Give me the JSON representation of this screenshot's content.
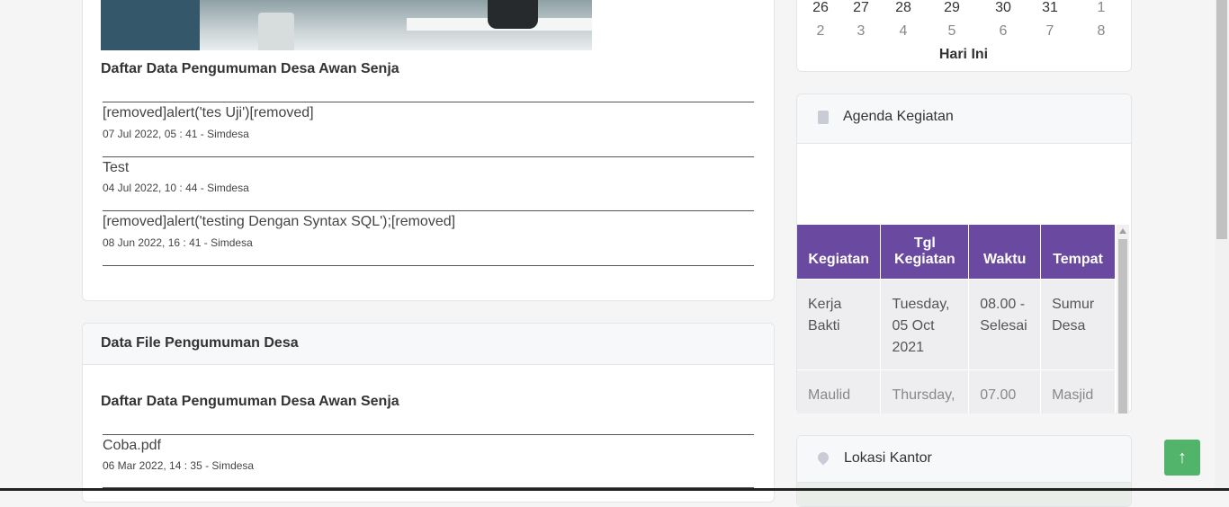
{
  "left": {
    "announcements_card": {
      "title": "Daftar Data Pengumuman Desa Awan Senja",
      "items": [
        {
          "title": "[removed]alert('tes Uji')[removed]",
          "meta": "07 Jul 2022, 05 : 41 - Simdesa"
        },
        {
          "title": "Test",
          "meta": "04 Jul 2022, 10 : 44 - Simdesa"
        },
        {
          "title": "[removed]alert('testing Dengan Syntax SQL');[removed]",
          "meta": "08 Jun 2022, 16 : 41 - Simdesa"
        }
      ]
    },
    "files_card": {
      "header": "Data File Pengumuman Desa",
      "title": "Daftar Data Pengumuman Desa Awan Senja",
      "items": [
        {
          "title": "Coba.pdf",
          "meta": "06 Mar 2022, 14 : 35 - Simdesa"
        }
      ]
    }
  },
  "right": {
    "calendar": {
      "row1": [
        "26",
        "27",
        "28",
        "29",
        "30",
        "31",
        "1"
      ],
      "row2": [
        "2",
        "3",
        "4",
        "5",
        "6",
        "7",
        "8"
      ],
      "today_label": "Hari Ini"
    },
    "agenda": {
      "header": "Agenda Kegiatan",
      "icon": "clipboard-icon",
      "columns": [
        "Kegiatan",
        "Tgl Kegiatan",
        "Waktu",
        "Tempat"
      ],
      "rows": [
        [
          "Kerja Bakti",
          "Tuesday, 05 Oct 2021",
          "08.00 - Selesai",
          "Sumur Desa"
        ],
        [
          "Maulid",
          "Thursday,",
          "07.00",
          "Masjid"
        ]
      ]
    },
    "location": {
      "header": "Lokasi Kantor",
      "icon": "map-pin-icon"
    }
  },
  "scroll_top_icon": "↑"
}
